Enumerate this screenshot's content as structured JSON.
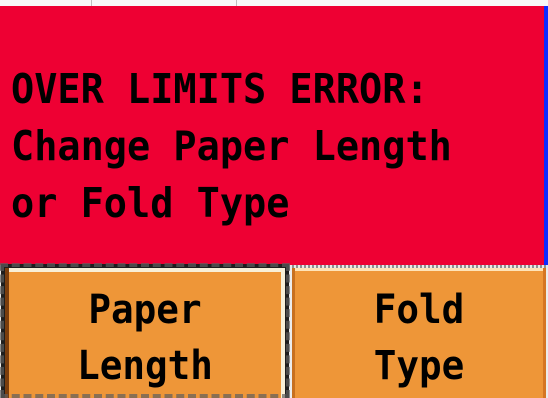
{
  "error_panel": {
    "lines": [
      "OVER LIMITS ERROR:",
      "Change Paper Length",
      "or Fold Type"
    ],
    "background_color": "#ee0033",
    "text_color": "#000000",
    "border_color": "#0b2cff"
  },
  "buttons": [
    {
      "label_lines": [
        "Paper",
        "Length"
      ],
      "state": "selected",
      "background_color": "#ee9638"
    },
    {
      "label_lines": [
        "Fold",
        "Type"
      ],
      "state": "normal",
      "background_color": "#ee9638"
    }
  ],
  "colors": {
    "page_background": "#f4f4f4",
    "text": "#000000"
  }
}
